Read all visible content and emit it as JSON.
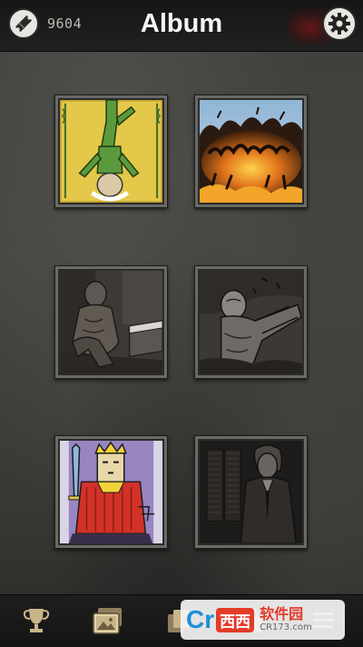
{
  "header": {
    "title": "Album",
    "coin_count": "9604",
    "ticket_icon": "ticket-icon",
    "settings_icon": "gear-icon"
  },
  "album": {
    "cards": [
      {
        "name": "hanged-man-card"
      },
      {
        "name": "explosion-card"
      },
      {
        "name": "seated-prisoner-card"
      },
      {
        "name": "fallen-man-card"
      },
      {
        "name": "king-card"
      },
      {
        "name": "man-in-suit-card"
      }
    ]
  },
  "nav": {
    "items": [
      {
        "icon": "trophy-icon"
      },
      {
        "icon": "album-icon"
      },
      {
        "icon": "cards-icon"
      },
      {
        "icon": "shop-icon"
      },
      {
        "icon": "menu-icon"
      }
    ]
  },
  "watermark": {
    "logo": "Cr",
    "badge": "西西",
    "text": "软件园",
    "url": "CR173.com"
  },
  "colors": {
    "header_bg": "#1a1a1a",
    "background": "#3f3f3c",
    "nav_icon": "#c9b58a",
    "button_bg": "#e8e6e1"
  }
}
